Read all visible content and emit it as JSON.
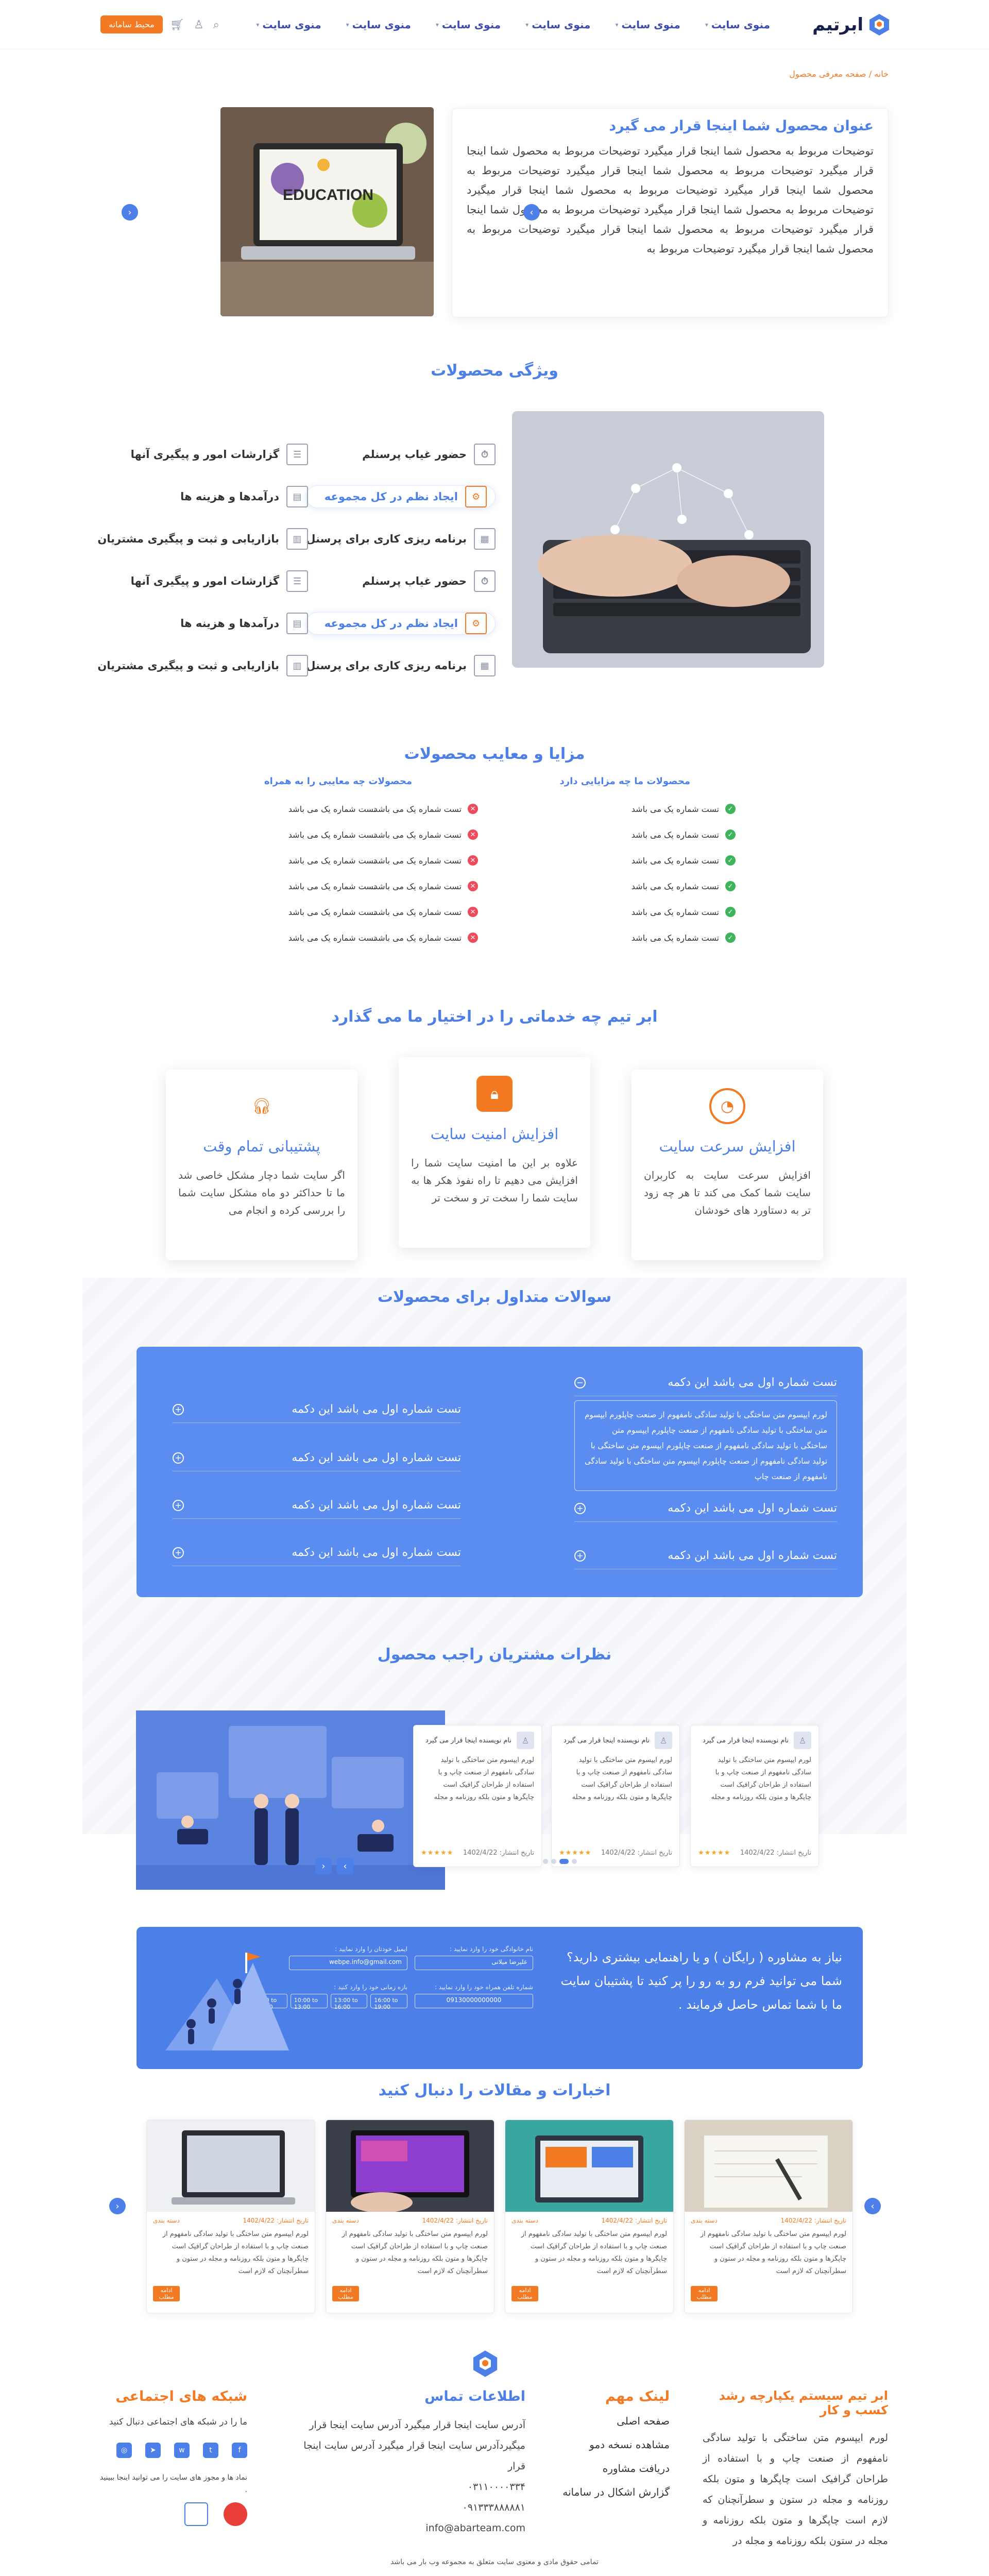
{
  "header": {
    "logo_text": "ابرتیم",
    "nav": [
      "منوی سایت",
      "منوی سایت",
      "منوی سایت",
      "منوی سایت",
      "منوی سایت",
      "منوی سایت"
    ],
    "demo_button": "محیط سامانه"
  },
  "breadcrumb": "خانه / صفحه معرفی محصول",
  "hero": {
    "title": "عنوان محصول شما اینجا قرار می گیرد",
    "body": "توضیحات مربوط به محصول شما اینجا قرار میگیرد توضیحات مربوط به محصول شما اینجا قرار میگیرد توضیحات مربوط به محصول شما اینجا قرار میگیرد توضیحات مربوط به محصول شما اینجا قرار میگیرد توضیحات مربوط به محصول شما اینجا قرار میگیرد توضیحات مربوط به محصول شما اینجا قرار میگیرد توضیحات مربوط به محصول شما اینجا قرار میگیرد توضیحات مربوط به محصول شما اینجا قرار میگیرد توضیحات مربوط به محصول شما اینجا قرار میگیرد توضیحات مربوط به",
    "image_text": "EDUCATION"
  },
  "features": {
    "title": "ویژگی محصولات",
    "col_right": [
      "حضور غیاب پرسنلم",
      "ایجاد نظم در کل مجموعه",
      "برنامه ریزی کاری برای پرسنل",
      "حضور غیاب پرسنلم",
      "ایجاد نظم در کل مجموعه",
      "برنامه ریزی کاری برای پرسنل"
    ],
    "col_left": [
      "گزارشات امور و پیگیری آنها",
      "درآمدها و هزینه ها",
      "بازاریابی و ثبت و پیگیری مشتریان",
      "گزارشات امور و پیگیری آنها",
      "درآمدها و هزینه ها",
      "بازاریابی و ثبت و پیگیری مشتریان"
    ]
  },
  "pros_cons": {
    "title": "مزایا و معایب محصولات",
    "pros_title": "محصولات ما چه مزایایی دارد",
    "cons_title": "محصولات چه معایبی را به همراه",
    "pros": [
      "تست شماره یک می باشد",
      "تست شماره یک می باشد",
      "تست شماره یک می باشد",
      "تست شماره یک می باشد",
      "تست شماره یک می باشد",
      "تست شماره یک می باشد"
    ],
    "cons": [
      "تست شماره یک می باشد",
      "تست شماره یک می باشد",
      "تست شماره یک می باشد",
      "تست شماره یک می باشد",
      "تست شماره یک می باشد",
      "تست شماره یک می باشد"
    ],
    "cons_extra": [
      "تست شماره یک می باشد",
      "تست شماره یک می باشد",
      "تست شماره یک می باشد",
      "تست شماره یک می باشد",
      "تست شماره یک می باشد",
      "تست شماره یک می باشد"
    ]
  },
  "services": {
    "title": "ابر تیم چه خدماتی را در اختیار ما می گذارد",
    "cards": [
      {
        "title": "افزایش سرعت سایت",
        "text": "افزایش سرعت سایت به کاربران سایت شما کمک می کند تا هر چه زود تر به دستاورد های خودشان",
        "icon": "speedometer-icon",
        "color": "#f37a22"
      },
      {
        "title": "افزایش امنیت سایت",
        "text": "علاوه بر این ما امنیت سایت شما را افزایش می دهیم تا راه نفوذ هکر ها به سایت شما را سخت تر و سخت تر",
        "icon": "lock-icon",
        "color": "#f37a22"
      },
      {
        "title": "پشتیبانی تمام وقت",
        "text": "اگر سایت شما دچار مشکل خاصی شد ما تا حداکثر دو ماه مشکل سایت شما را بررسی کرده و انجام می",
        "icon": "headset-icon",
        "color": "#f37a22"
      }
    ]
  },
  "faq": {
    "title": "سوالات متداول برای محصولات",
    "question": "تست شماره اول می باشد این دکمه",
    "answer": "لورم ایپسوم متن ساختگی با تولید سادگی نامفهوم از صنعت چاپلورم ایپسوم متن ساختگی با تولید سادگی نامفهوم از صنعت چاپلورم ایپسوم متن ساختگی با تولید سادگی نامفهوم از صنعت چاپلورم ایپسوم متن ساختگی با تولید سادگی نامفهوم از صنعت چاپلورم ایپسوم متن ساختگی با تولید سادگی نامفهوم از صنعت چاپ"
  },
  "testimonials": {
    "title": "نظرات مشتریان راجب محصول",
    "name": "نام نویسنده اینجا قرار می گیرد",
    "body": "لورم ایپسوم متن ساختگی با تولید سادگی نامفهوم از صنعت چاپ و با استفاده از طراحان گرافیک است چاپگرها و متون بلکه روزنامه و مجله",
    "date": "تاریخ انتشار: 1402/4/22",
    "rating": 5,
    "prev": "‹",
    "next": "›"
  },
  "contact": {
    "headline": "نیاز به مشاوره ( رایگان ) و یا راهنمایی بیشتری دارید؟ شما می توانید فرم رو به رو را پر کنید تا پشتیبان سایت ما با شما تماس حاصل فرمایند .",
    "name_label": "نام خانوادگی خود را وارد نمایید :",
    "name_value": "علیرضا میلانی",
    "email_label": "ایمیل خودتان را وارد نمایید :",
    "email_value": "webpe.info@gmail.com",
    "phone_label": "شماره تلفن همراه خود را وارد نمایید :",
    "phone_value": "09130000000000",
    "time_label": "بازه زمانی خود را وارد کنید :",
    "times": [
      "7:00 to 10:00",
      "10:00 to 13:00",
      "13:00 to 16:00",
      "16:00 to 19:00"
    ]
  },
  "news": {
    "title": "اخبارات و مقالات را دنبال کنید",
    "date": "تاریخ انتشار: 1402/4/22",
    "category": "دسته بندی",
    "body": "لورم ایپسوم متن ساختگی با تولید سادگی نامفهوم از صنعت چاپ و با استفاده از طراحان گرافیک است چاپگرها و متون بلکه روزنامه و مجله در ستون و سطرآنچنان که لازم است",
    "more": "ادامه مطلب"
  },
  "footer": {
    "about_title": "ابر تیم سیستم یکپارچه رشد کسب و کار",
    "about_text": "لورم ایپسوم متن ساختگی با تولید سادگی نامفهوم از صنعت چاپ و با استفاده از طراحان گرافیک است چاپگرها و متون بلکه روزنامه و مجله در ستون و سطرآنچنان که لازم است چاپگرها و متون بلکه روزنامه و مجله در ستون بلکه روزنامه و مجله در",
    "links_title": "لینک مهم",
    "links": [
      "صفحه اصلی",
      "مشاهده نسخه دمو",
      "دریافت مشاوره",
      "گزارش اشکال در سامانه"
    ],
    "contact_title": "اطلاعات تماس",
    "address": "آدرس سایت اینجا قرار میگیرد آدرس سایت اینجا قرار میگیردآدرس سایت اینجا قرار میگیرد آدرس سایت اینجا قرار",
    "phone1": "۰۳۱۱۰۰۰۰۳۳۴",
    "phone2": "۰۹۱۳۳۳۸۸۸۸۸۱",
    "email": "info@abarteam.com",
    "social_title": "شبکه های اجتماعی",
    "social_text": "ما را در شبکه های اجتماعی دنبال کنید",
    "license_text": "نماد ها و مجوز های سایت را می توانید اینجا ببینید .",
    "copyright": "تمامی حقوق مادی و معنوی سایت متعلق به مجموعه وب بار می باشد"
  }
}
